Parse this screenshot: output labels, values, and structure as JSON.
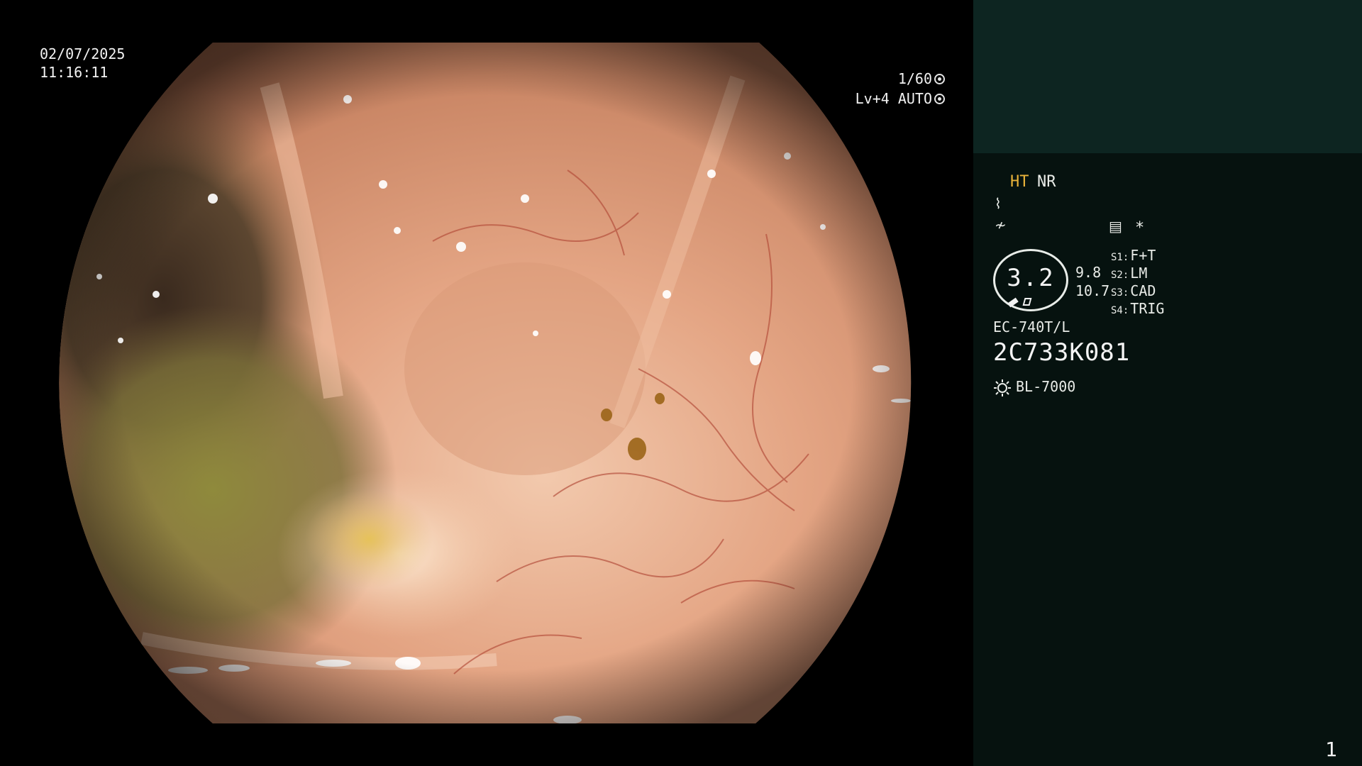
{
  "overlay": {
    "date": "02/07/2025",
    "time": "11:16:11",
    "shutter": "1/60",
    "iris": "Lv+4 AUTO"
  },
  "panel": {
    "ht_label": "HT",
    "nr_label": "NR",
    "tone_icon": "tone-curve-icon",
    "enhance_icon": "enhance-icon",
    "freeze_icon": "freeze-icon",
    "asterisk": "*",
    "scale_value": "3.2",
    "value_upper": "9.8",
    "value_lower": "10.7",
    "switches": [
      {
        "key": "S1:",
        "value": "F+T"
      },
      {
        "key": "S2:",
        "value": "LM"
      },
      {
        "key": "S3:",
        "value": "CAD"
      },
      {
        "key": "S4:",
        "value": "TRIG"
      }
    ],
    "scope_model": "EC-740T/L",
    "serial": "2C733K081",
    "light_icon": "light-source-icon",
    "light_source": "BL-7000",
    "page_number": "1"
  },
  "colors": {
    "panel_bg": "#06120f",
    "panel_top": "#0d2521",
    "ht_accent": "#e8b23a"
  }
}
